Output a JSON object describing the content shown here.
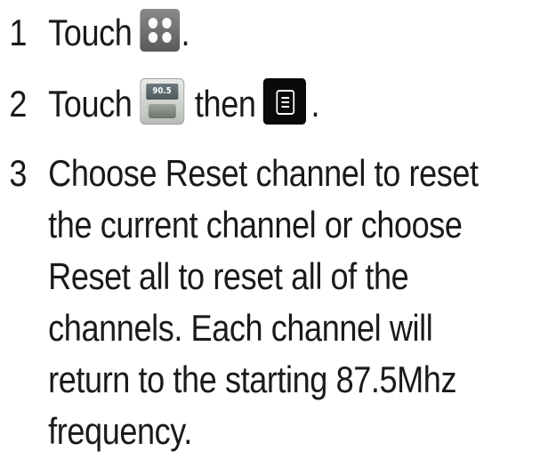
{
  "steps": [
    {
      "number": "1",
      "text_before": "Touch",
      "text_after": ".",
      "icon": "apps-grid-icon"
    },
    {
      "number": "2",
      "text_before": "Touch",
      "radio_icon_display": "90.5",
      "text_middle": "then",
      "text_after": ".",
      "icons": [
        "fm-radio-icon",
        "menu-icon"
      ]
    },
    {
      "number": "3",
      "lines": [
        "Choose Reset channel to reset",
        "the current channel or choose",
        "Reset all to reset all of the",
        "channels. Each channel will",
        "return to the starting 87.5Mhz",
        "frequency."
      ]
    }
  ]
}
